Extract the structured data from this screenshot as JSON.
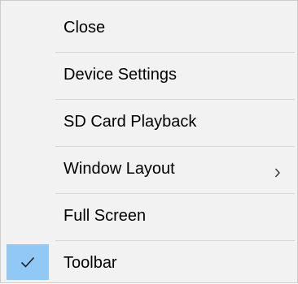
{
  "menu": {
    "items": [
      {
        "label": "Close"
      },
      {
        "label": "Device Settings"
      },
      {
        "label": "SD Card Playback"
      },
      {
        "label": "Window Layout",
        "submenu_icon": "chevron-right-icon"
      },
      {
        "label": "Full Screen"
      },
      {
        "label": "Toolbar",
        "checked": true,
        "check_icon": "checkmark-icon"
      }
    ]
  },
  "colors": {
    "menu_background": "#f2f2f2",
    "checked_highlight": "#90c8f6",
    "separator": "#d7d7d7",
    "text": "#000000"
  }
}
